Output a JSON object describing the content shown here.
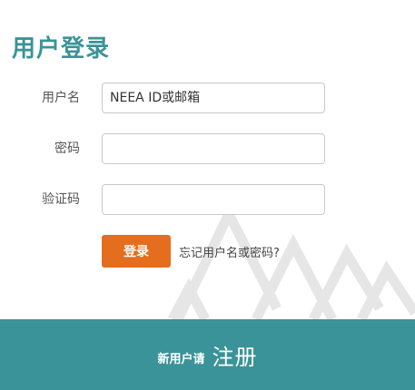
{
  "colors": {
    "accent_teal": "#3a9398",
    "button_orange": "#e46d1e",
    "deco_line": "#e6e6e6"
  },
  "login": {
    "title": "用户登录",
    "username": {
      "label": "用户名",
      "placeholder": "NEEA ID或邮箱",
      "value": ""
    },
    "password": {
      "label": "密码",
      "value": ""
    },
    "captcha": {
      "label": "验证码",
      "value": ""
    },
    "submit_label": "登录",
    "forgot_link": "忘记用户名或密码?"
  },
  "footer": {
    "prefix": "新用户请",
    "register_label": "注册"
  },
  "icons": [
    "triangle-pattern-decoration"
  ]
}
